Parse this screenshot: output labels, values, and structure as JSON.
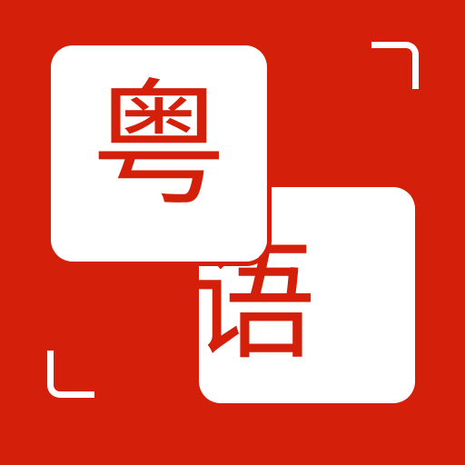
{
  "icon": {
    "top_character": "粤",
    "bottom_character": "语",
    "background_color": "#d41f0a",
    "tile_color": "#ffffff",
    "glyph_color": "#d41f0a",
    "bracket_icons": [
      "corner-bracket-top-right-icon",
      "corner-bracket-bottom-left-icon"
    ]
  }
}
